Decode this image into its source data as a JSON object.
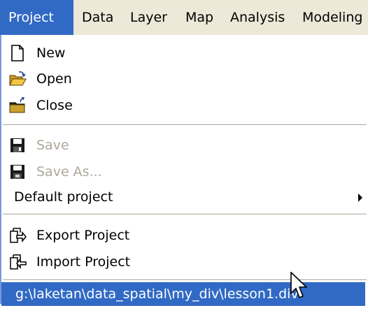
{
  "menubar": {
    "items": [
      {
        "label": "Project",
        "active": true
      },
      {
        "label": "Data"
      },
      {
        "label": "Layer"
      },
      {
        "label": "Map"
      },
      {
        "label": "Analysis"
      },
      {
        "label": "Modeling"
      }
    ]
  },
  "project_menu": {
    "new": {
      "label": "New",
      "icon": "new-document-icon"
    },
    "open": {
      "label": "Open",
      "icon": "open-folder-icon"
    },
    "close": {
      "label": "Close",
      "icon": "close-folder-icon"
    },
    "save": {
      "label": "Save",
      "icon": "save-disk-icon",
      "enabled": false
    },
    "save_as": {
      "label": "Save As...",
      "icon": "save-as-disk-icon",
      "enabled": false
    },
    "default_project": {
      "label": "Default project",
      "has_submenu": true
    },
    "export_project": {
      "label": "Export Project",
      "icon": "export-icon"
    },
    "import_project": {
      "label": "Import Project",
      "icon": "import-icon"
    },
    "recent_file": {
      "label": "g:\\laketan\\data_spatial\\my_div\\lesson1.div",
      "highlighted": true
    }
  },
  "colors": {
    "highlight": "#316ac5",
    "menubar_bg": "#ece9d8",
    "disabled_text": "#aca899"
  }
}
